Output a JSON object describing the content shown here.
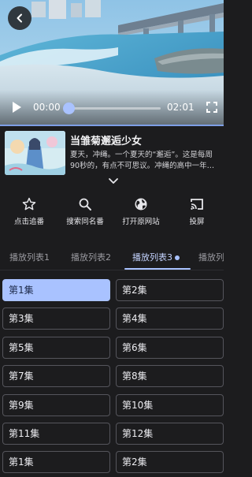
{
  "player": {
    "current_time": "00:00",
    "duration": "02:01",
    "progress": 0.02
  },
  "show": {
    "title": "当雏菊邂逅少女",
    "description": "夏天，冲绳。一个夏天的“邂逅”。这是每周90秒的，有点不可思议。冲绳的高中一年…"
  },
  "actions": [
    {
      "label": "点击追番",
      "icon": "star-icon"
    },
    {
      "label": "搜索同名番",
      "icon": "search-icon"
    },
    {
      "label": "打开原网站",
      "icon": "globe-icon"
    },
    {
      "label": "投屏",
      "icon": "cast-icon"
    }
  ],
  "tabs": [
    "播放列表1",
    "播放列表2",
    "播放列表3",
    "播放列"
  ],
  "active_tab": 2,
  "episodes": [
    "第1集",
    "第2集",
    "第3集",
    "第4集",
    "第5集",
    "第6集",
    "第7集",
    "第8集",
    "第9集",
    "第10集",
    "第11集",
    "第12集",
    "第1集",
    "第2集"
  ],
  "selected_episode": 0,
  "colors": {
    "background": "#1c1c1e",
    "accent": "#a9c2ff",
    "selected_text": "#1d2a4a"
  }
}
